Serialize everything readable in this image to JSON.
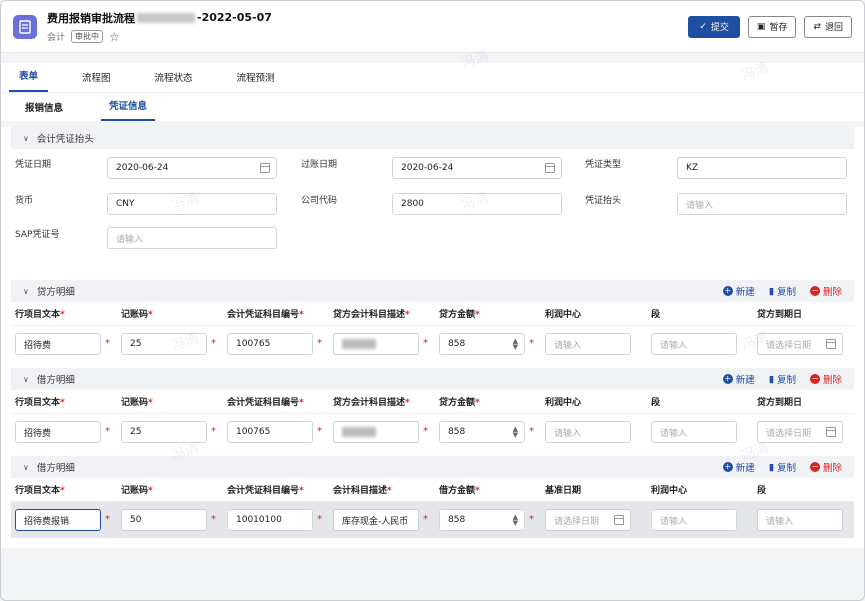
{
  "header": {
    "title_prefix": "费用报销审批流程",
    "title_suffix": "-2022-05-07",
    "role": "会计",
    "status_badge": "审批中",
    "submit_label": "提交",
    "save_label": "暂存",
    "return_label": "退回"
  },
  "tabs": [
    "表单",
    "流程图",
    "流程状态",
    "流程预测"
  ],
  "subtabs": [
    "报销信息",
    "凭证信息"
  ],
  "voucher_header": {
    "title": "会计凭证抬头",
    "fields": {
      "voucher_date_label": "凭证日期",
      "voucher_date_value": "2020-06-24",
      "posting_date_label": "过账日期",
      "posting_date_value": "2020-06-24",
      "voucher_type_label": "凭证类型",
      "voucher_type_value": "KZ",
      "currency_label": "货币",
      "currency_value": "CNY",
      "company_code_label": "公司代码",
      "company_code_value": "2800",
      "voucher_header_label": "凭证抬头",
      "voucher_header_placeholder": "请输入",
      "sap_no_label": "SAP凭证号",
      "sap_no_placeholder": "请输入"
    }
  },
  "actions": {
    "new": "新建",
    "copy": "复制",
    "delete": "删除"
  },
  "credit": {
    "title": "贷方明细",
    "columns": [
      "行项目文本",
      "记账码",
      "会计凭证科目编号",
      "贷方会计科目描述",
      "贷方金额",
      "利润中心",
      "段",
      "贷方到期日"
    ],
    "row": {
      "text": "招待费",
      "code": "25",
      "account": "100765",
      "amount": "858",
      "profit_ph": "请输入",
      "segment_ph": "请输入",
      "due_ph": "请选择日期"
    }
  },
  "debit1": {
    "title": "借方明细",
    "columns": [
      "行项目文本",
      "记账码",
      "会计凭证科目编号",
      "贷方会计科目描述",
      "贷方金额",
      "利润中心",
      "段",
      "贷方到期日"
    ],
    "row": {
      "text": "招待费",
      "code": "25",
      "account": "100765",
      "amount": "858",
      "profit_ph": "请输入",
      "segment_ph": "请输入",
      "due_ph": "请选择日期"
    }
  },
  "debit2": {
    "title": "借方明细",
    "columns": [
      "行项目文本",
      "记账码",
      "会计凭证科目编号",
      "会计科目描述",
      "借方金额",
      "基准日期",
      "利润中心",
      "段"
    ],
    "row": {
      "text": "招待费报销",
      "code": "50",
      "account": "10010100",
      "desc": "库存现金-人民币",
      "amount": "858",
      "date_ph": "请选择日期",
      "profit_ph": "请输入",
      "segment_ph": "请输入"
    }
  },
  "watermark": "冯清"
}
